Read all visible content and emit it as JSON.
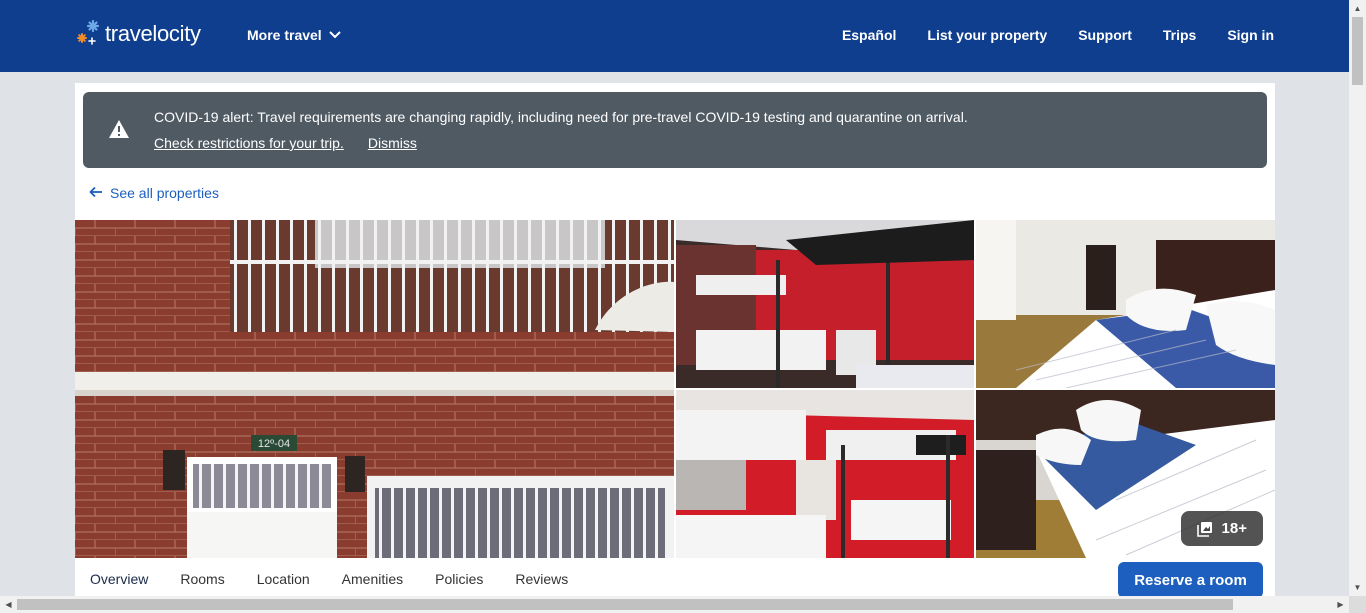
{
  "header": {
    "logo_text": "travelocity",
    "more_travel": "More travel",
    "nav": [
      "Español",
      "List your property",
      "Support",
      "Trips",
      "Sign in"
    ]
  },
  "alert": {
    "message": "COVID-19 alert: Travel requirements are changing rapidly, including need for pre-travel COVID-19 testing and quarantine on arrival.",
    "link_check": "Check restrictions for your trip.",
    "link_dismiss": "Dismiss",
    "icon": "warning-icon"
  },
  "back_link": "See all properties",
  "gallery": {
    "photo_count": "18+",
    "photos": [
      "building-exterior",
      "bunk-room",
      "bedroom-double",
      "bunk-room-2",
      "bedroom-double-2"
    ]
  },
  "tabs": [
    "Overview",
    "Rooms",
    "Location",
    "Amenities",
    "Policies",
    "Reviews"
  ],
  "reserve_button": "Reserve a room",
  "colors": {
    "header_bg": "#0f3e8f",
    "alert_bg": "#4f5a63",
    "link": "#1d5fbf",
    "button": "#1d5fbf"
  }
}
